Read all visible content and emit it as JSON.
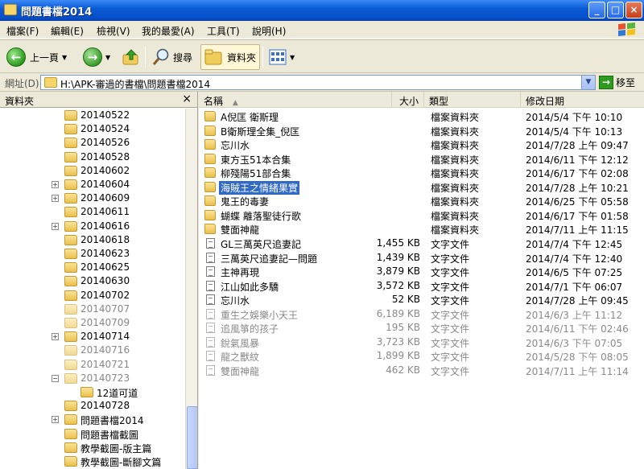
{
  "window": {
    "title": "問題書檔2014",
    "controls": [
      "_",
      "□",
      "×"
    ]
  },
  "menu": [
    "檔案(F)",
    "編輯(E)",
    "檢視(V)",
    "我的最愛(A)",
    "工具(T)",
    "說明(H)"
  ],
  "toolbar": {
    "back": "上一頁",
    "search": "搜尋",
    "folders": "資料夾"
  },
  "address": {
    "label": "網址(D)",
    "path": "H:\\APK-審過的書檔\\問題書檔2014",
    "go": "移至"
  },
  "folder_pane": {
    "title": "資料夾",
    "close": "×",
    "items": [
      {
        "label": "20140522",
        "expander": "",
        "faded": false
      },
      {
        "label": "20140524",
        "expander": "",
        "faded": false
      },
      {
        "label": "20140526",
        "expander": "",
        "faded": false
      },
      {
        "label": "20140528",
        "expander": "",
        "faded": false
      },
      {
        "label": "20140602",
        "expander": "",
        "faded": false
      },
      {
        "label": "20140604",
        "expander": "+",
        "faded": false
      },
      {
        "label": "20140609",
        "expander": "+",
        "faded": false
      },
      {
        "label": "20140611",
        "expander": "",
        "faded": false
      },
      {
        "label": "20140616",
        "expander": "+",
        "faded": false
      },
      {
        "label": "20140618",
        "expander": "",
        "faded": false
      },
      {
        "label": "20140623",
        "expander": "",
        "faded": false
      },
      {
        "label": "20140625",
        "expander": "",
        "faded": false
      },
      {
        "label": "20140630",
        "expander": "",
        "faded": false
      },
      {
        "label": "20140702",
        "expander": "",
        "faded": false
      },
      {
        "label": "20140707",
        "expander": "",
        "faded": true
      },
      {
        "label": "20140709",
        "expander": "",
        "faded": true
      },
      {
        "label": "20140714",
        "expander": "+",
        "faded": false
      },
      {
        "label": "20140716",
        "expander": "",
        "faded": true
      },
      {
        "label": "20140721",
        "expander": "",
        "faded": true
      },
      {
        "label": "20140723",
        "expander": "−",
        "faded": true
      },
      {
        "label": "12道可道",
        "expander": "",
        "faded": false,
        "child": true
      },
      {
        "label": "20140728",
        "expander": "",
        "faded": false
      },
      {
        "label": "問題書檔2014",
        "expander": "+",
        "faded": false
      },
      {
        "label": "問題書檔截圖",
        "expander": "",
        "faded": false
      },
      {
        "label": "教學截圖-版主篇",
        "expander": "",
        "faded": false
      },
      {
        "label": "教學截圖-斷腳文篇",
        "expander": "",
        "faded": false
      }
    ]
  },
  "file_list": {
    "columns": [
      "名稱",
      "大小",
      "類型",
      "修改日期"
    ],
    "sort_indicator": "▲",
    "rows": [
      {
        "name": "A倪匡 衛斯理",
        "size": "",
        "type": "檔案資料夾",
        "date": "2014/5/4 下午 10:10",
        "kind": "folder",
        "faded": false,
        "selected": false
      },
      {
        "name": "B衛斯理全集_倪匡",
        "size": "",
        "type": "檔案資料夾",
        "date": "2014/5/4 下午 10:13",
        "kind": "folder",
        "faded": false,
        "selected": false
      },
      {
        "name": "忘川水",
        "size": "",
        "type": "檔案資料夾",
        "date": "2014/7/28 上午 09:47",
        "kind": "folder",
        "faded": false,
        "selected": false
      },
      {
        "name": "東方玉51本合集",
        "size": "",
        "type": "檔案資料夾",
        "date": "2014/6/11 下午 12:12",
        "kind": "folder",
        "faded": false,
        "selected": false
      },
      {
        "name": "柳殘陽51部合集",
        "size": "",
        "type": "檔案資料夾",
        "date": "2014/6/17 下午 02:08",
        "kind": "folder",
        "faded": false,
        "selected": false
      },
      {
        "name": "海賊王之情緒果實",
        "size": "",
        "type": "檔案資料夾",
        "date": "2014/7/28 上午 10:21",
        "kind": "folder",
        "faded": false,
        "selected": true
      },
      {
        "name": "鬼王的毒妻",
        "size": "",
        "type": "檔案資料夾",
        "date": "2014/6/25 下午 05:58",
        "kind": "folder",
        "faded": false,
        "selected": false
      },
      {
        "name": "蝴蝶 離落聖徒行歌",
        "size": "",
        "type": "檔案資料夾",
        "date": "2014/6/17 下午 01:58",
        "kind": "folder",
        "faded": false,
        "selected": false
      },
      {
        "name": "雙面神龍",
        "size": "",
        "type": "檔案資料夾",
        "date": "2014/7/11 上午 11:15",
        "kind": "folder",
        "faded": false,
        "selected": false
      },
      {
        "name": "GL三萬英尺追妻記",
        "size": "1,455 KB",
        "type": "文字文件",
        "date": "2014/7/4 下午 12:45",
        "kind": "doc",
        "faded": false,
        "selected": false
      },
      {
        "name": "三萬英尺追妻記—問題",
        "size": "1,439 KB",
        "type": "文字文件",
        "date": "2014/7/4 下午 12:40",
        "kind": "doc",
        "faded": false,
        "selected": false
      },
      {
        "name": "主神再現",
        "size": "3,879 KB",
        "type": "文字文件",
        "date": "2014/6/5 下午 07:25",
        "kind": "doc",
        "faded": false,
        "selected": false
      },
      {
        "name": "江山如此多驕",
        "size": "3,572 KB",
        "type": "文字文件",
        "date": "2014/7/1 下午 06:07",
        "kind": "doc",
        "faded": false,
        "selected": false
      },
      {
        "name": "忘川水",
        "size": "52 KB",
        "type": "文字文件",
        "date": "2014/7/28 上午 09:45",
        "kind": "doc",
        "faded": false,
        "selected": false
      },
      {
        "name": "重生之娛樂小天王",
        "size": "6,189 KB",
        "type": "文字文件",
        "date": "2014/6/3 上午 11:12",
        "kind": "doc",
        "faded": true,
        "selected": false
      },
      {
        "name": "追風箏的孩子",
        "size": "195 KB",
        "type": "文字文件",
        "date": "2014/6/11 下午 02:46",
        "kind": "doc",
        "faded": true,
        "selected": false
      },
      {
        "name": "銳氣風暴",
        "size": "3,723 KB",
        "type": "文字文件",
        "date": "2014/6/3 下午 07:05",
        "kind": "doc",
        "faded": true,
        "selected": false
      },
      {
        "name": "龍之獸紋",
        "size": "1,899 KB",
        "type": "文字文件",
        "date": "2014/5/28 下午 08:05",
        "kind": "doc",
        "faded": true,
        "selected": false
      },
      {
        "name": "雙面神龍",
        "size": "462 KB",
        "type": "文字文件",
        "date": "2014/7/11 上午 11:14",
        "kind": "doc",
        "faded": true,
        "selected": false
      }
    ]
  },
  "colors": {
    "title_bar": "#0650c9",
    "selection": "#316ac5",
    "folder": "#e9c04c"
  }
}
